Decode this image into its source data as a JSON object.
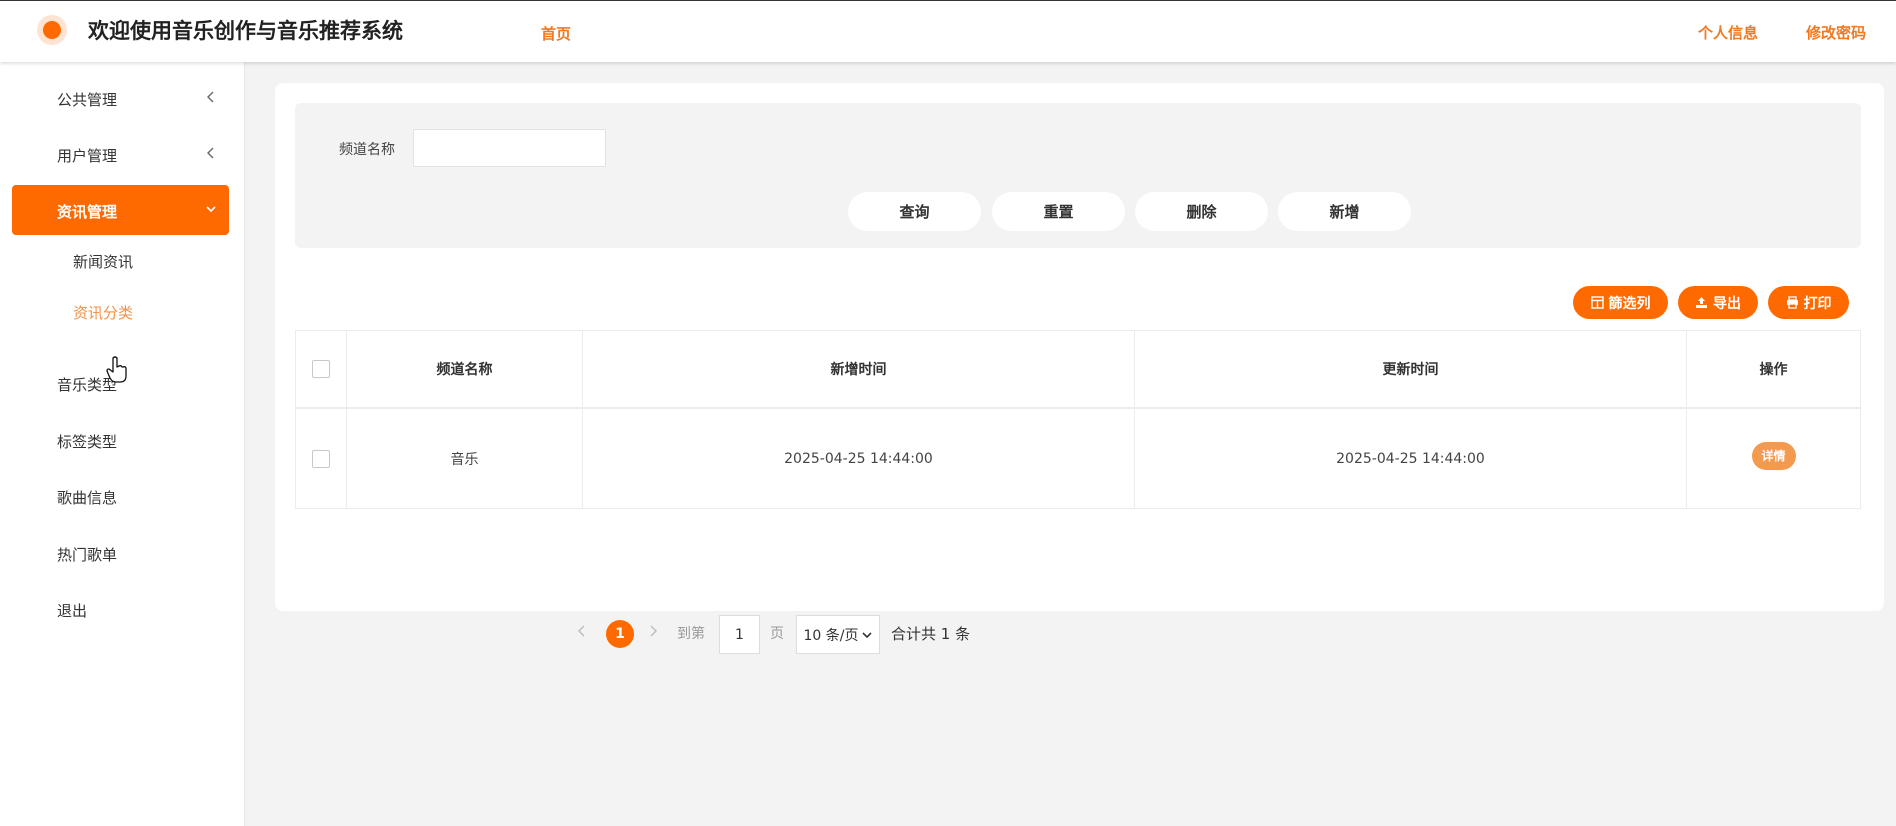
{
  "header": {
    "title": "欢迎使用音乐创作与音乐推荐系统",
    "nav_home": "首页",
    "nav_profile": "个人信息",
    "nav_password": "修改密码"
  },
  "sidebar": {
    "items": [
      {
        "label": "公共管理",
        "icon": "chevron-left-icon"
      },
      {
        "label": "用户管理",
        "icon": "chevron-left-icon"
      },
      {
        "label": "资讯管理",
        "icon": "chevron-down-icon",
        "active": true
      },
      {
        "label": "音乐类型"
      },
      {
        "label": "标签类型"
      },
      {
        "label": "歌曲信息"
      },
      {
        "label": "热门歌单"
      },
      {
        "label": "退出"
      }
    ],
    "sub_items": [
      {
        "label": "新闻资讯"
      },
      {
        "label": "资讯分类",
        "current": true
      }
    ]
  },
  "search": {
    "field_label": "频道名称",
    "field_value": "",
    "buttons": {
      "query": "查询",
      "reset": "重置",
      "delete": "删除",
      "add": "新增"
    }
  },
  "toolbar": {
    "filter_columns": "篩选列",
    "export": "导出",
    "print": "打印"
  },
  "table": {
    "headers": {
      "name": "频道名称",
      "created": "新增时间",
      "updated": "更新时间",
      "action": "操作"
    },
    "rows": [
      {
        "name": "音乐",
        "created": "2025-04-25 14:44:00",
        "updated": "2025-04-25 14:44:00",
        "action": "详情"
      }
    ]
  },
  "pagination": {
    "current_page": "1",
    "goto_prefix": "到第",
    "goto_value": "1",
    "goto_suffix": "页",
    "page_size": "10 条/页",
    "total": "合计共 1 条"
  },
  "colors": {
    "accent": "#ff6a00",
    "accent_light": "#f2914a",
    "background": "#f3f3f3"
  }
}
